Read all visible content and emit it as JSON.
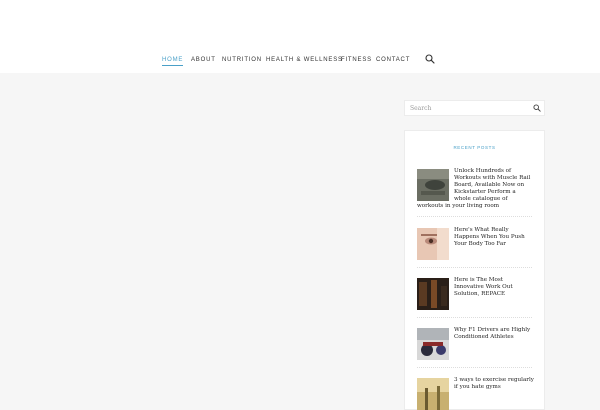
{
  "nav": {
    "items": [
      {
        "label": "HOME",
        "active": true
      },
      {
        "label": "ABOUT",
        "active": false
      },
      {
        "label": "NUTRITION",
        "active": false
      },
      {
        "label": "HEALTH & WELLNESS",
        "active": false
      },
      {
        "label": "FITNESS",
        "active": false
      },
      {
        "label": "CONTACT",
        "active": false
      }
    ],
    "search_icon": "search-icon"
  },
  "sidebar": {
    "search": {
      "placeholder": "Search",
      "button_icon": "search-icon"
    },
    "recent_posts": {
      "title": "RECENT POSTS",
      "posts": [
        {
          "title": "Unlock Hundreds of Workouts with Muscle Rail Board, Available Now on Kickstarter Perform a whole catalogue of workouts in your living room"
        },
        {
          "title": "Here's What Really Happens When You Push Your Body Too Far"
        },
        {
          "title": "Here is The Most Innovative Work Out Solution, REPACE"
        },
        {
          "title": "Why F1 Drivers are Highly Conditioned Athletes"
        },
        {
          "title": "3 ways to exercise regularly if you hate gyms"
        }
      ]
    }
  },
  "colors": {
    "accent": "#4aa0c8",
    "page_background": "#f6f6f6",
    "header_background": "#ffffff"
  }
}
